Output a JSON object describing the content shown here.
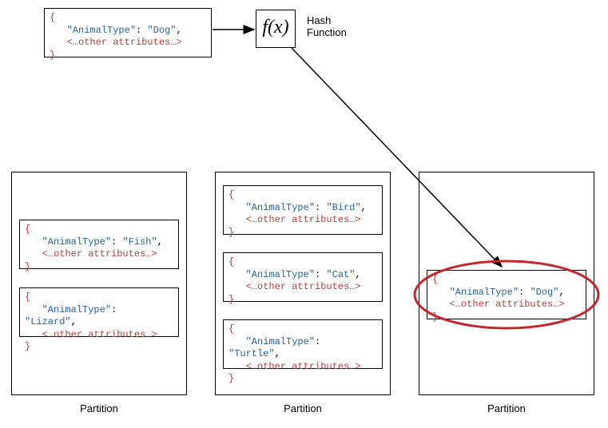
{
  "hashFunction": {
    "symbol": "f(x)",
    "label": "Hash Function"
  },
  "input": {
    "openBrace": "{",
    "closeBrace": "}",
    "keyQuoted": "\"AnimalType\"",
    "colon": ": ",
    "valueQuoted": "\"Dog\"",
    "comma": ",",
    "other": "<…other attributes…>"
  },
  "partitions": [
    {
      "label": "Partition",
      "records": [
        {
          "key": "\"AnimalType\"",
          "value": "\"Fish\"",
          "other": "<…other attributes…>"
        },
        {
          "key": "\"AnimalType\"",
          "value": "\"Lizard\"",
          "other": "<…other attributes…>"
        }
      ]
    },
    {
      "label": "Partition",
      "records": [
        {
          "key": "\"AnimalType\"",
          "value": "\"Bird\"",
          "other": "<…other attributes…>"
        },
        {
          "key": "\"AnimalType\"",
          "value": "\"Cat\"",
          "other": "<…other attributes…>"
        },
        {
          "key": "\"AnimalType\"",
          "value": "\"Turtle\"",
          "other": "<…other attributes…>"
        }
      ]
    },
    {
      "label": "Partition",
      "records": [
        {
          "key": "\"AnimalType\"",
          "value": "\"Dog\"",
          "other": "<…other attributes…>"
        }
      ]
    }
  ],
  "braces": {
    "open": "{",
    "close": "}"
  },
  "colon": ": ",
  "comma": ","
}
